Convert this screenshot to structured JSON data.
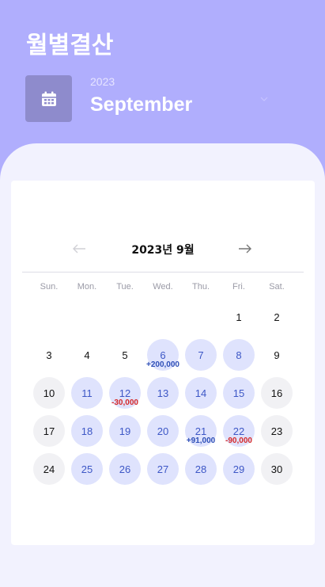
{
  "header": {
    "title": "월별결산",
    "year": "2023",
    "month": "September"
  },
  "calendar": {
    "title": "2023년 9월",
    "prev_label": "←",
    "next_label": "→",
    "weekdays": [
      "Sun.",
      "Mon.",
      "Tue.",
      "Wed.",
      "Thu.",
      "Fri.",
      "Sat."
    ],
    "days": [
      {
        "day": "1"
      },
      {
        "day": "2"
      },
      {
        "day": "3"
      },
      {
        "day": "4"
      },
      {
        "day": "5"
      },
      {
        "day": "6",
        "amount": "+200,000",
        "type": "pos"
      },
      {
        "day": "7"
      },
      {
        "day": "8"
      },
      {
        "day": "9"
      },
      {
        "day": "10"
      },
      {
        "day": "11"
      },
      {
        "day": "12",
        "amount": "-30,000",
        "type": "neg"
      },
      {
        "day": "13"
      },
      {
        "day": "14"
      },
      {
        "day": "15"
      },
      {
        "day": "16"
      },
      {
        "day": "17"
      },
      {
        "day": "18"
      },
      {
        "day": "19"
      },
      {
        "day": "20"
      },
      {
        "day": "21",
        "amount": "+91,000",
        "type": "pos"
      },
      {
        "day": "22",
        "amount": "-90,000",
        "type": "neg"
      },
      {
        "day": "23"
      },
      {
        "day": "24"
      },
      {
        "day": "25"
      },
      {
        "day": "26"
      },
      {
        "day": "27"
      },
      {
        "day": "28"
      },
      {
        "day": "29"
      },
      {
        "day": "30"
      }
    ]
  },
  "colors": {
    "background": "#b0aefd",
    "sheet": "#f2f2fe",
    "highlight": "#dfe3fd",
    "positive": "#2e4fb7",
    "negative": "#d62a2a"
  }
}
